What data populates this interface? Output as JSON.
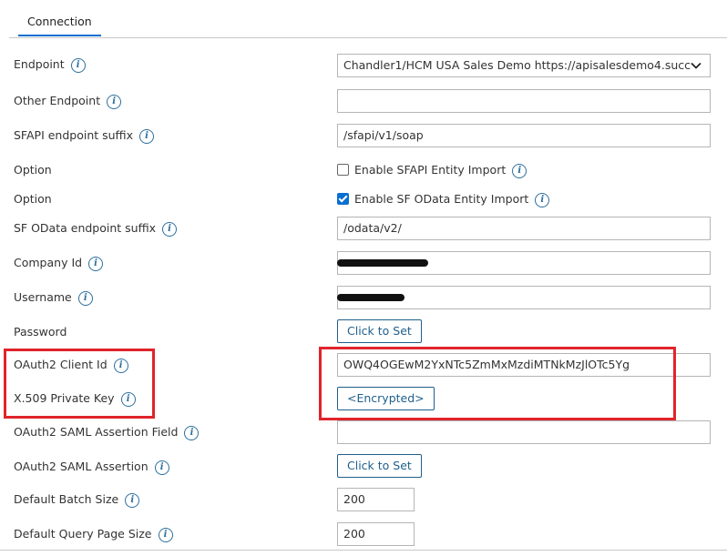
{
  "tabs": [
    {
      "label": "Connection",
      "active": true
    }
  ],
  "form": {
    "endpoint": {
      "label": "Endpoint",
      "value": "Chandler1/HCM USA Sales Demo https://apisalesdemo4.succ"
    },
    "other_endpoint": {
      "label": "Other Endpoint",
      "value": ""
    },
    "sfapi_suffix": {
      "label": "SFAPI endpoint suffix",
      "value": "/sfapi/v1/soap"
    },
    "option1": {
      "label": "Option",
      "checkbox_label": "Enable SFAPI Entity Import",
      "checked": false
    },
    "option2": {
      "label": "Option",
      "checkbox_label": "Enable SF OData Entity Import",
      "checked": true
    },
    "odata_suffix": {
      "label": "SF OData endpoint suffix",
      "value": "/odata/v2/"
    },
    "company_id": {
      "label": "Company Id",
      "value": "",
      "redacted": true
    },
    "username": {
      "label": "Username",
      "value": "",
      "redacted": true
    },
    "password": {
      "label": "Password",
      "button": "Click to Set"
    },
    "oauth2_client_id": {
      "label": "OAuth2 Client Id",
      "value": "OWQ4OGEwM2YxNTc5ZmMxMzdiMTNkMzJlOTc5Yg"
    },
    "x509_key": {
      "label": "X.509 Private Key",
      "button": "<Encrypted>"
    },
    "saml_field": {
      "label": "OAuth2 SAML Assertion Field",
      "value": ""
    },
    "saml_assertion": {
      "label": "OAuth2 SAML Assertion",
      "button": "Click to Set"
    },
    "batch_size": {
      "label": "Default Batch Size",
      "value": "200"
    },
    "page_size": {
      "label": "Default Query Page Size",
      "value": "200"
    }
  },
  "colors": {
    "highlight": "#e0242b",
    "accent": "#0a6ed1",
    "button_text": "#1f5f8b"
  }
}
